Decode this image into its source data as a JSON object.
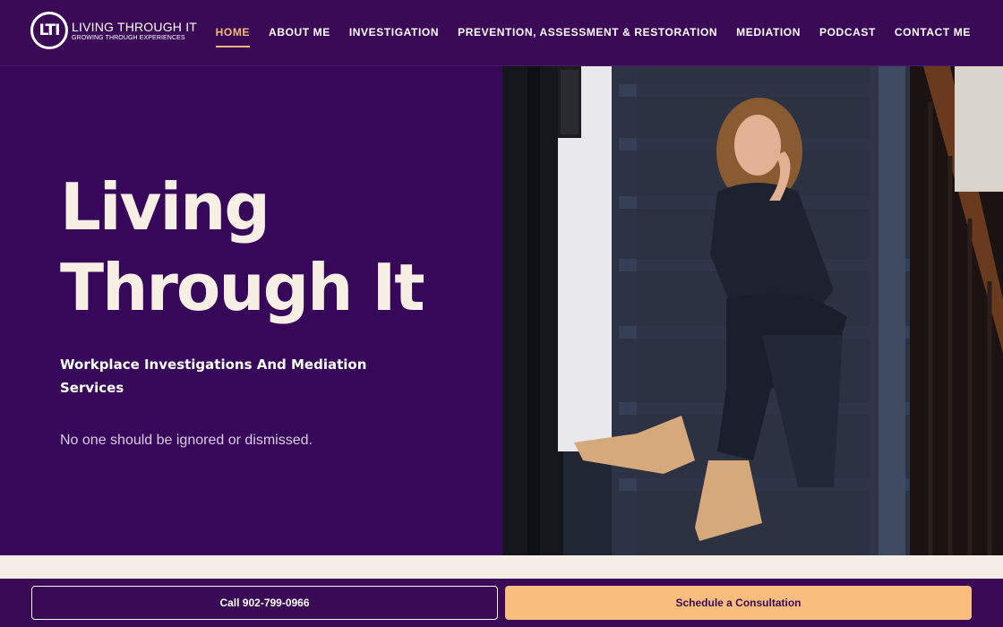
{
  "brand": {
    "mark": "LTI",
    "name": "LIVING THROUGH IT",
    "tagline": "GROWING THROUGH EXPERIENCES"
  },
  "nav": {
    "items": [
      {
        "label": "HOME",
        "active": true
      },
      {
        "label": "ABOUT ME"
      },
      {
        "label": "INVESTIGATION"
      },
      {
        "label": "PREVENTION, ASSESSMENT & RESTORATION"
      },
      {
        "label": "MEDIATION"
      },
      {
        "label": "PODCAST"
      },
      {
        "label": "CONTACT ME"
      }
    ]
  },
  "hero": {
    "title_line1": "Living",
    "title_line2": "Through It",
    "subtitle": "Workplace Investigations And Mediation Services",
    "tagline": "No one should be ignored or dismissed.",
    "image": "woman-on-stairs-photo"
  },
  "cta": {
    "call_label": "Call 902-799-0966",
    "schedule_label": "Schedule a Consultation"
  },
  "colors": {
    "primary": "#3a0a57",
    "hero_bg": "#37075a",
    "accent": "#f9bd7e",
    "cream": "#f4eee6"
  }
}
